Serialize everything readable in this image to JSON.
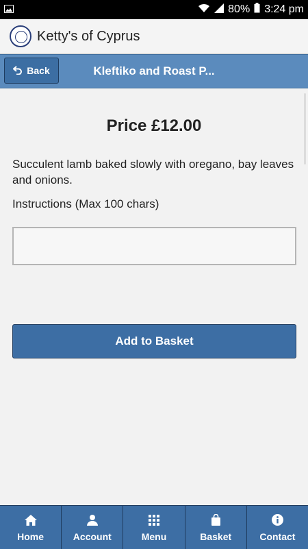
{
  "status_bar": {
    "battery": "80%",
    "time": "3:24 pm"
  },
  "app": {
    "title": "Ketty's of Cyprus"
  },
  "header": {
    "back_label": "Back",
    "title": "Kleftiko and Roast P..."
  },
  "product": {
    "price": "Price £12.00",
    "description": "Succulent lamb baked slowly with oregano, bay leaves and onions.",
    "instructions_label": "Instructions (Max 100 chars)",
    "instructions_value": "",
    "add_button": "Add to Basket"
  },
  "nav": [
    {
      "label": "Home",
      "icon": "home-icon"
    },
    {
      "label": "Account",
      "icon": "user-icon"
    },
    {
      "label": "Menu",
      "icon": "grid-icon"
    },
    {
      "label": "Basket",
      "icon": "bag-icon"
    },
    {
      "label": "Contact",
      "icon": "info-icon"
    }
  ]
}
